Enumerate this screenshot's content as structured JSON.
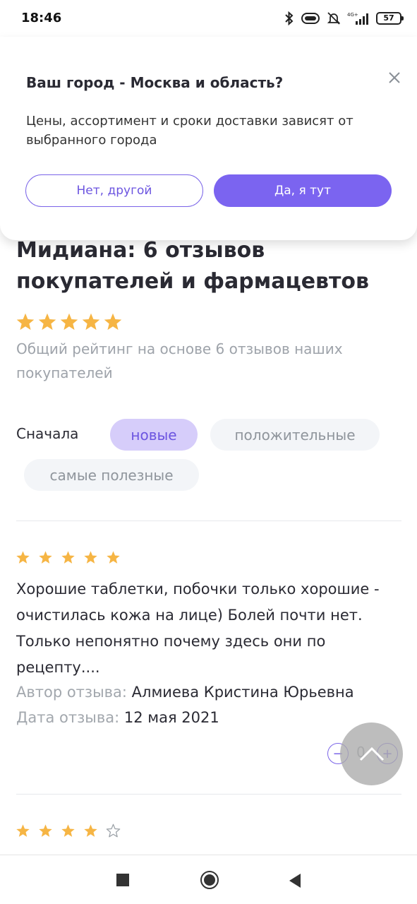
{
  "status_bar": {
    "time": "18:46",
    "battery": "57"
  },
  "city_popup": {
    "title": "Ваш город - Москва и область?",
    "text": "Цены, ассортимент и сроки доставки зависят от выбранного города",
    "no_button": "Нет, другой",
    "yes_button": "Да, я тут"
  },
  "page": {
    "title": "Мидиана: 6 отзывов покупателей и фармацевтов",
    "overall_rating": 5,
    "rating_note": "Общий рейтинг на основе 6 отзывов наших покупателей"
  },
  "sort": {
    "label": "Сначала",
    "options": [
      "новые",
      "положительные",
      "самые полезные"
    ],
    "selected": "новые"
  },
  "reviews": [
    {
      "rating": 5,
      "text": "Хорошие таблетки, побочки только хорошие - очистилась кожа на лице) Болей почти нет. Только непонятно почему здесь они по рецепту....",
      "author_label": "Автор отзыва:",
      "author": "Алмиева Кристина Юрьевна",
      "date_label": "Дата отзыва:",
      "date": "12 мая 2021",
      "votes": "0"
    },
    {
      "rating": 4
    }
  ],
  "colors": {
    "accent": "#7b64f0",
    "star": "#f6b544",
    "chip_selected_bg": "#d6cdfa",
    "chip_bg": "#f3f5f8"
  }
}
